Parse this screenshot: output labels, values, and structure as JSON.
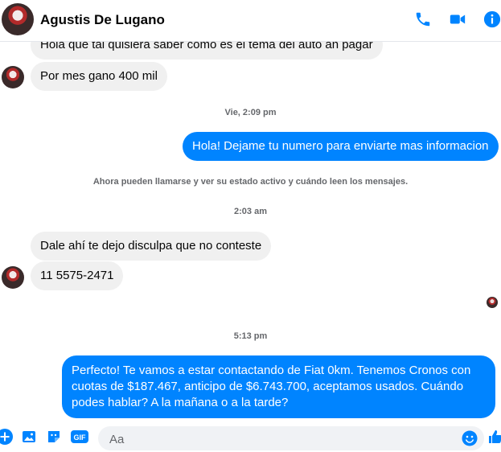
{
  "header": {
    "contact_name": "Agustis De Lugano",
    "icons": [
      "phone-icon",
      "video-camera-icon",
      "info-icon"
    ]
  },
  "messages": {
    "m1": "Hola que tal quisiera saber como es el tema del auto an pagar",
    "m2": "Por mes gano 400 mil",
    "ts1": "Vie, 2:09 pm",
    "m3": "Hola! Dejame tu numero para enviarte mas informacion",
    "notice": "Ahora pueden llamarse y ver su estado activo y cuándo leen los mensajes.",
    "ts2": "2:03 am",
    "m4": "Dale ahí te dejo disculpa que no conteste",
    "m5": "11 5575-2471",
    "ts3": "5:13 pm",
    "m6": "Perfecto! Te vamos a estar contactando de Fiat 0km. Tenemos Cronos con cuotas de $187.467, anticipo de $6.743.700, aceptamos usados. Cuándo podes hablar? A la mañana o a la tarde?"
  },
  "composer": {
    "placeholder": "Aa",
    "icons": [
      "plus-icon",
      "image-icon",
      "sticker-icon",
      "gif-icon",
      "emoji-icon",
      "like-icon"
    ],
    "gif_label": "GIF"
  },
  "colors": {
    "accent": "#0084ff",
    "incoming_bubble": "#f0f0f0",
    "muted_text": "#65676b"
  }
}
